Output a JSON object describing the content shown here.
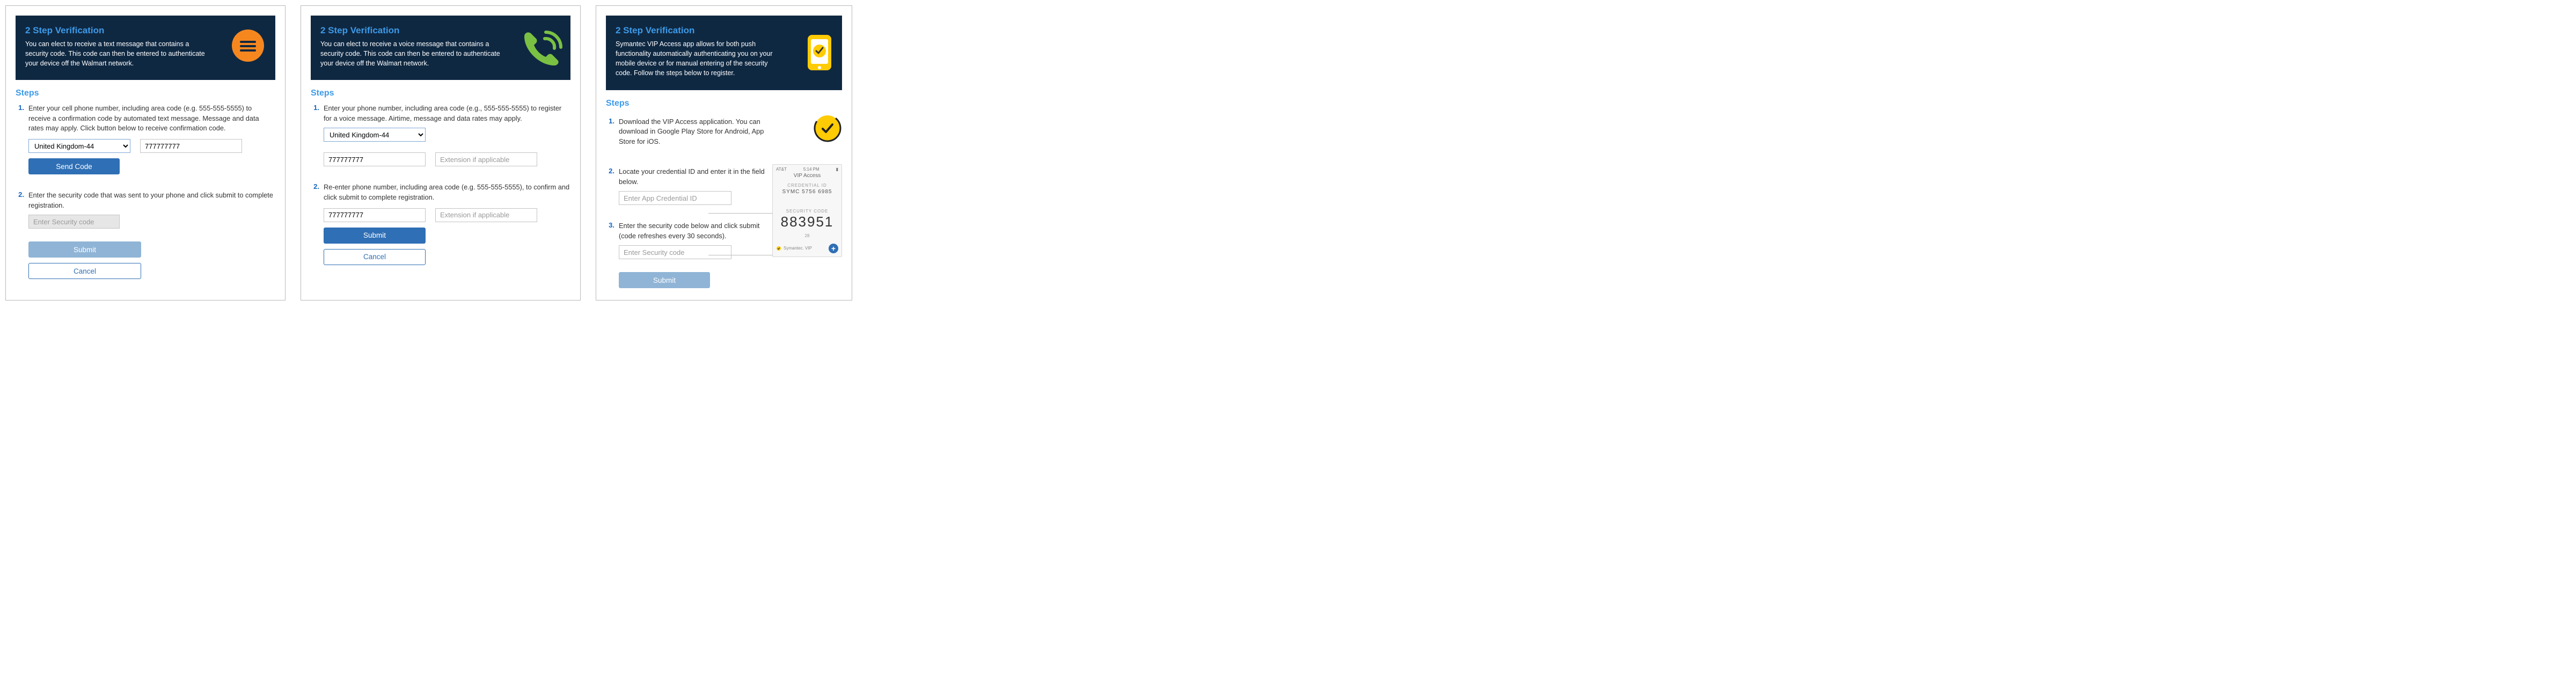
{
  "panel1": {
    "header_title": "2 Step Verification",
    "header_desc": "You can elect to receive a text message that contains a security code. This code can then be entered to authenticate your device off the Walmart network.",
    "steps_heading": "Steps",
    "step1_num": "1.",
    "step1_text": "Enter your cell phone number, including area code (e.g. 555-555-5555) to receive a confirmation code by automated text message. Message and data rates may apply. Click button below to receive confirmation code.",
    "country_selected": "United Kingdom-44",
    "phone_value": "777777777",
    "send_code_label": "Send Code",
    "step2_num": "2.",
    "step2_text": "Enter the security code that was sent to your phone and click submit to complete registration.",
    "security_placeholder": "Enter Security code",
    "submit_label": "Submit",
    "cancel_label": "Cancel"
  },
  "panel2": {
    "header_title": "2 Step Verification",
    "header_desc": "You can elect to receive a voice message that contains a security code. This code can then be entered to authenticate your device off the Walmart network.",
    "steps_heading": "Steps",
    "step1_num": "1.",
    "step1_text": "Enter your phone number, including area code (e.g., 555-555-5555) to register for a voice message. Airtime, message and data rates may apply.",
    "country_selected": "United Kingdom-44",
    "phone_value": "777777777",
    "ext_placeholder": "Extension if applicable",
    "step2_num": "2.",
    "step2_text": "Re-enter phone number, including area code (e.g. 555-555-5555), to confirm and click submit to complete registration.",
    "phone_value2": "777777777",
    "submit_label": "Submit",
    "cancel_label": "Cancel"
  },
  "panel3": {
    "header_title": "2 Step Verification",
    "header_desc": "Symantec VIP Access app allows for both push functionality automatically authenticating you on your mobile device or for manual entering of the security code. Follow the steps below to register.",
    "steps_heading": "Steps",
    "step1_num": "1.",
    "step1_text": "Download the VIP Access application. You can download in Google Play Store for Android, App Store for iOS.",
    "step2_num": "2.",
    "step2_text": "Locate your credential ID and enter it in the field below.",
    "credential_placeholder": "Enter App Credential ID",
    "step3_num": "3.",
    "step3_text": "Enter the security code below and click submit (code refreshes every 30 seconds).",
    "security_placeholder": "Enter Security code",
    "submit_label": "Submit",
    "vip_preview": {
      "carrier": "AT&T",
      "time": "5:14 PM",
      "title": "VIP Access",
      "cred_label": "CREDENTIAL ID",
      "cred_value": "SYMC 5756 6985",
      "code_label": "SECURITY CODE",
      "code_value": "883951",
      "countdown": "28",
      "brand": "Symantec. VIP"
    }
  }
}
